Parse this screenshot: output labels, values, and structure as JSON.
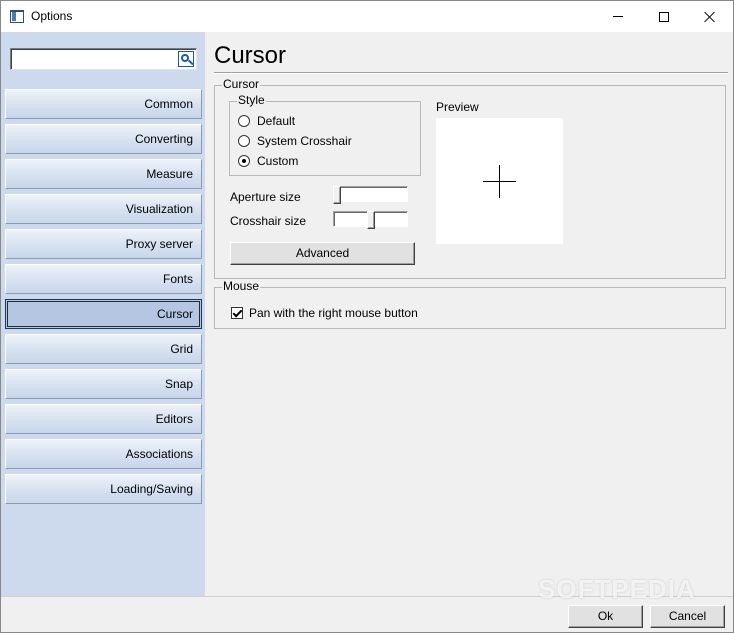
{
  "window": {
    "title": "Options",
    "icon": "app-window-icon",
    "controls": {
      "minimize": "minimize-icon",
      "maximize": "maximize-icon",
      "close": "close-icon"
    }
  },
  "sidebar": {
    "search": {
      "value": "",
      "placeholder": "",
      "icon": "search-icon"
    },
    "items": [
      {
        "label": "Common"
      },
      {
        "label": "Converting"
      },
      {
        "label": "Measure"
      },
      {
        "label": "Visualization"
      },
      {
        "label": "Proxy server"
      },
      {
        "label": "Fonts"
      },
      {
        "label": "Cursor"
      },
      {
        "label": "Grid"
      },
      {
        "label": "Snap"
      },
      {
        "label": "Editors"
      },
      {
        "label": "Associations"
      },
      {
        "label": "Loading/Saving"
      }
    ],
    "selected": "Cursor"
  },
  "main": {
    "title": "Cursor",
    "cursor_group": {
      "title": "Cursor",
      "style_group": {
        "title": "Style",
        "options": [
          "Default",
          "System Crosshair",
          "Custom"
        ],
        "selected": "Custom"
      },
      "preview_label": "Preview",
      "aperture_label": "Aperture size",
      "aperture_level": 0.0,
      "crosshair_label": "Crosshair size",
      "crosshair_level": 0.5,
      "advanced_label": "Advanced"
    },
    "mouse_group": {
      "title": "Mouse",
      "pan_label": "Pan with the right mouse button",
      "pan_checked": true
    }
  },
  "footer": {
    "ok_label": "Ok",
    "cancel_label": "Cancel"
  },
  "watermark": "SOFTPEDIA"
}
